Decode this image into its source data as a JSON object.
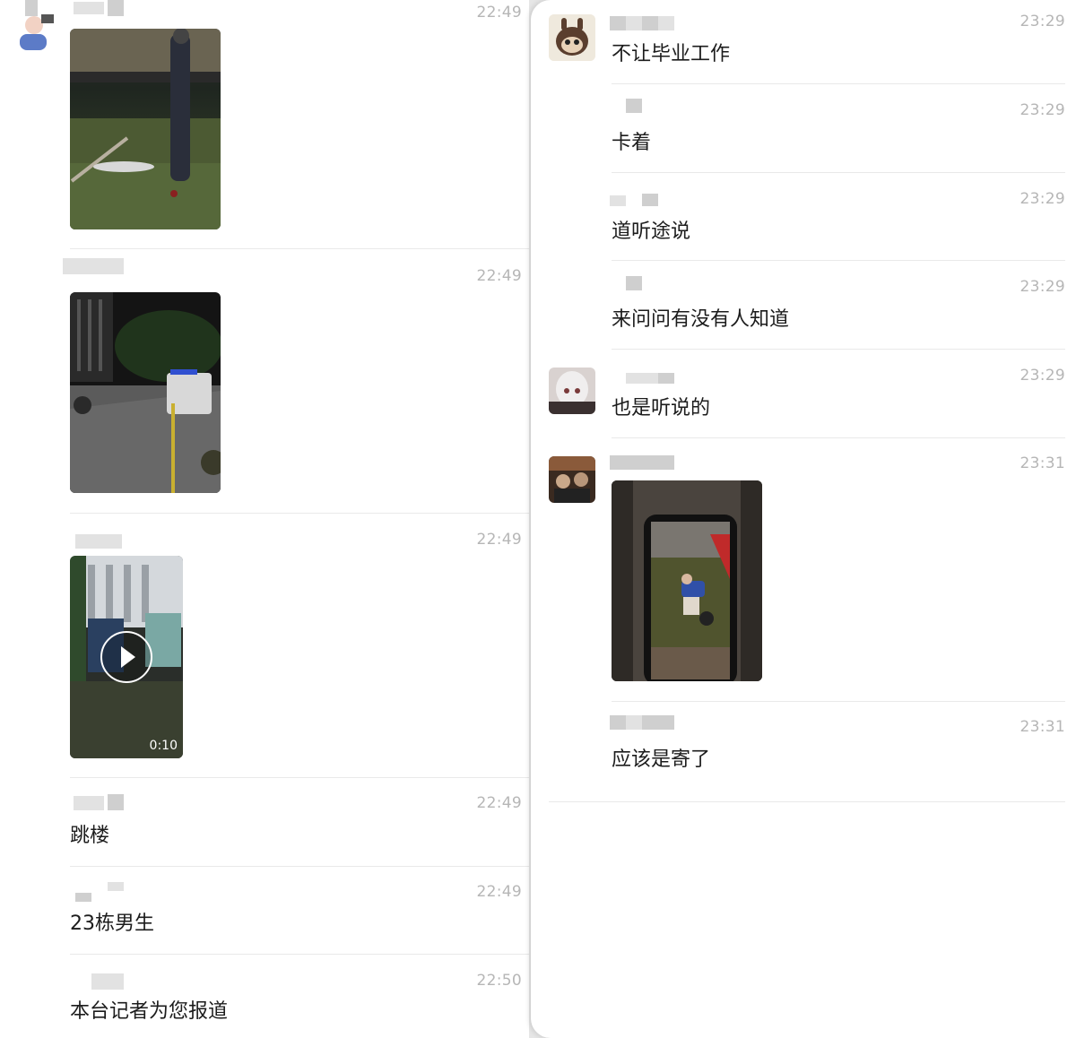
{
  "left_panel": {
    "messages": [
      {
        "time": "22:49",
        "type": "image"
      },
      {
        "time": "22:49",
        "type": "image"
      },
      {
        "time": "22:49",
        "type": "video",
        "duration": "0:10"
      },
      {
        "time": "22:49",
        "type": "text",
        "text": "跳楼"
      },
      {
        "time": "22:49",
        "type": "text",
        "text": "23栋男生"
      },
      {
        "time": "22:50",
        "type": "text",
        "text": "本台记者为您报道"
      }
    ]
  },
  "right_panel": {
    "messages": [
      {
        "time": "23:29",
        "type": "text",
        "text": "不让毕业工作"
      },
      {
        "time": "23:29",
        "type": "text",
        "text": "卡着"
      },
      {
        "time": "23:29",
        "type": "text",
        "text": "道听途说"
      },
      {
        "time": "23:29",
        "type": "text",
        "text": "来问问有没有人知道"
      },
      {
        "time": "23:29",
        "type": "text",
        "text": "也是听说的"
      },
      {
        "time": "23:31",
        "type": "image"
      },
      {
        "time": "23:31",
        "type": "text",
        "text": "应该是寄了"
      }
    ]
  },
  "colors": {
    "background": "#ffffff",
    "timestamp": "#b6b6b6",
    "text": "#1c1c1c",
    "divider": "#e9e9e9"
  }
}
